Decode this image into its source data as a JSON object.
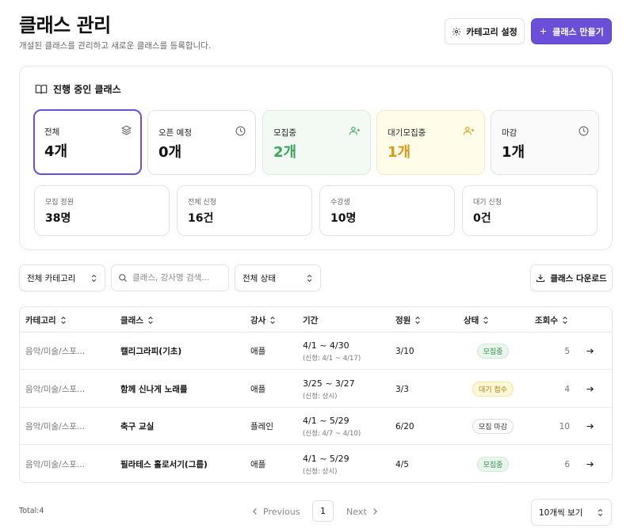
{
  "header": {
    "title": "클래스 관리",
    "subtitle": "개설된 클래스를 관리하고 새로운 클래스를 등록합니다.",
    "category_settings_label": "카테고리 설정",
    "create_class_label": "클래스 만들기"
  },
  "overview": {
    "title": "진행 중인 클래스",
    "stats": [
      {
        "label": "전체",
        "value": "4개",
        "icon": "layers-icon"
      },
      {
        "label": "오픈 예정",
        "value": "0개",
        "icon": "clock-icon"
      },
      {
        "label": "모집중",
        "value": "2개",
        "icon": "user-plus-icon"
      },
      {
        "label": "대기모집중",
        "value": "1개",
        "icon": "user-plus-icon"
      },
      {
        "label": "마감",
        "value": "1개",
        "icon": "clock-icon"
      }
    ],
    "summary": [
      {
        "label": "모집 정원",
        "value": "38명"
      },
      {
        "label": "전체 신청",
        "value": "16건"
      },
      {
        "label": "수강생",
        "value": "10명"
      },
      {
        "label": "대기 신청",
        "value": "0건"
      }
    ]
  },
  "filters": {
    "category_select": "전체 카테고리",
    "search_placeholder": "클래스, 강사명 검색...",
    "status_select": "전체 상태",
    "download_label": "클래스 다운로드"
  },
  "table": {
    "columns": {
      "category": "카테고리",
      "class": "클래스",
      "instructor": "강사",
      "period": "기간",
      "capacity": "정원",
      "status": "상태",
      "views": "조회수"
    },
    "rows": [
      {
        "category": "음악/미술/스포...",
        "class": "캘리그라피(기초)",
        "instructor": "애플",
        "period": "4/1 ~ 4/30",
        "apply": "(신청: 4/1 ~ 4/17)",
        "capacity": "3/10",
        "status": "모집중",
        "views": "5"
      },
      {
        "category": "음악/미술/스포...",
        "class": "함께 신나게 노래를",
        "instructor": "애플",
        "period": "3/25 ~ 3/27",
        "apply": "(신청: 상시)",
        "capacity": "3/3",
        "status": "대기 접수",
        "views": "4"
      },
      {
        "category": "음악/미술/스포...",
        "class": "축구 교실",
        "instructor": "플레인",
        "period": "4/1 ~ 5/29",
        "apply": "(신청: 4/7 ~ 4/10)",
        "capacity": "6/20",
        "status": "모집 마감",
        "views": "10"
      },
      {
        "category": "음악/미술/스포...",
        "class": "필라테스 홀로서기(그룹)",
        "instructor": "애플",
        "period": "4/1 ~ 5/29",
        "apply": "(신청: 상시)",
        "capacity": "4/5",
        "status": "모집중",
        "views": "6"
      }
    ]
  },
  "footer": {
    "total": "Total:4",
    "previous_label": "Previous",
    "page": "1",
    "next_label": "Next",
    "per_page": "10개씩 보기"
  },
  "colors": {
    "accent": "#6b4fd8",
    "green": "#3aa55a",
    "yellow": "#d89a11"
  }
}
